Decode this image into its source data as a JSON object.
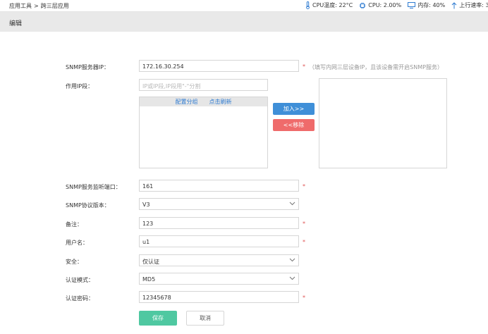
{
  "topbar": {
    "breadcrumb": {
      "parent": "应用工具",
      "separator": ">",
      "current": "跨三层应用"
    },
    "stats": {
      "cpu_temp": "CPU温度: 22°C",
      "cpu": "CPU: 2.00%",
      "memory": "内存: 40%",
      "upload": "上行速率: 3"
    }
  },
  "section": {
    "title": "编辑"
  },
  "form": {
    "snmp_server_ip": {
      "label": "SNMP服务器IP：",
      "value": "172.16.30.254",
      "required": "*",
      "hint": "（填写内网三层设备IP，且该设备需开启SNMP服务）"
    },
    "ip_range": {
      "label": "作用IP段：",
      "placeholder": "IP或IP段,IP段用\"-\"分割"
    },
    "list_actions": {
      "config_group": "配置分组",
      "refresh": "点击刷新"
    },
    "add_button": "加入>>",
    "remove_button": "<<移除",
    "snmp_port": {
      "label": "SNMP服务监听端口：",
      "value": "161",
      "required": "*"
    },
    "snmp_version": {
      "label": "SNMP协议版本：",
      "value": "V3"
    },
    "remark": {
      "label": "备注：",
      "value": "123",
      "required": "*"
    },
    "username": {
      "label": "用户名：",
      "value": "u1",
      "required": "*"
    },
    "security": {
      "label": "安全：",
      "value": "仅认证"
    },
    "auth_mode": {
      "label": "认证模式：",
      "value": "MD5"
    },
    "auth_password": {
      "label": "认证密码：",
      "value": "12345678",
      "required": "*"
    }
  },
  "buttons": {
    "save": "保存",
    "cancel": "取消"
  },
  "colors": {
    "add": "#3f8fd8",
    "remove": "#ef6b6b",
    "save": "#4fc8a1",
    "link": "#2e7bd1",
    "required": "#e05555"
  }
}
